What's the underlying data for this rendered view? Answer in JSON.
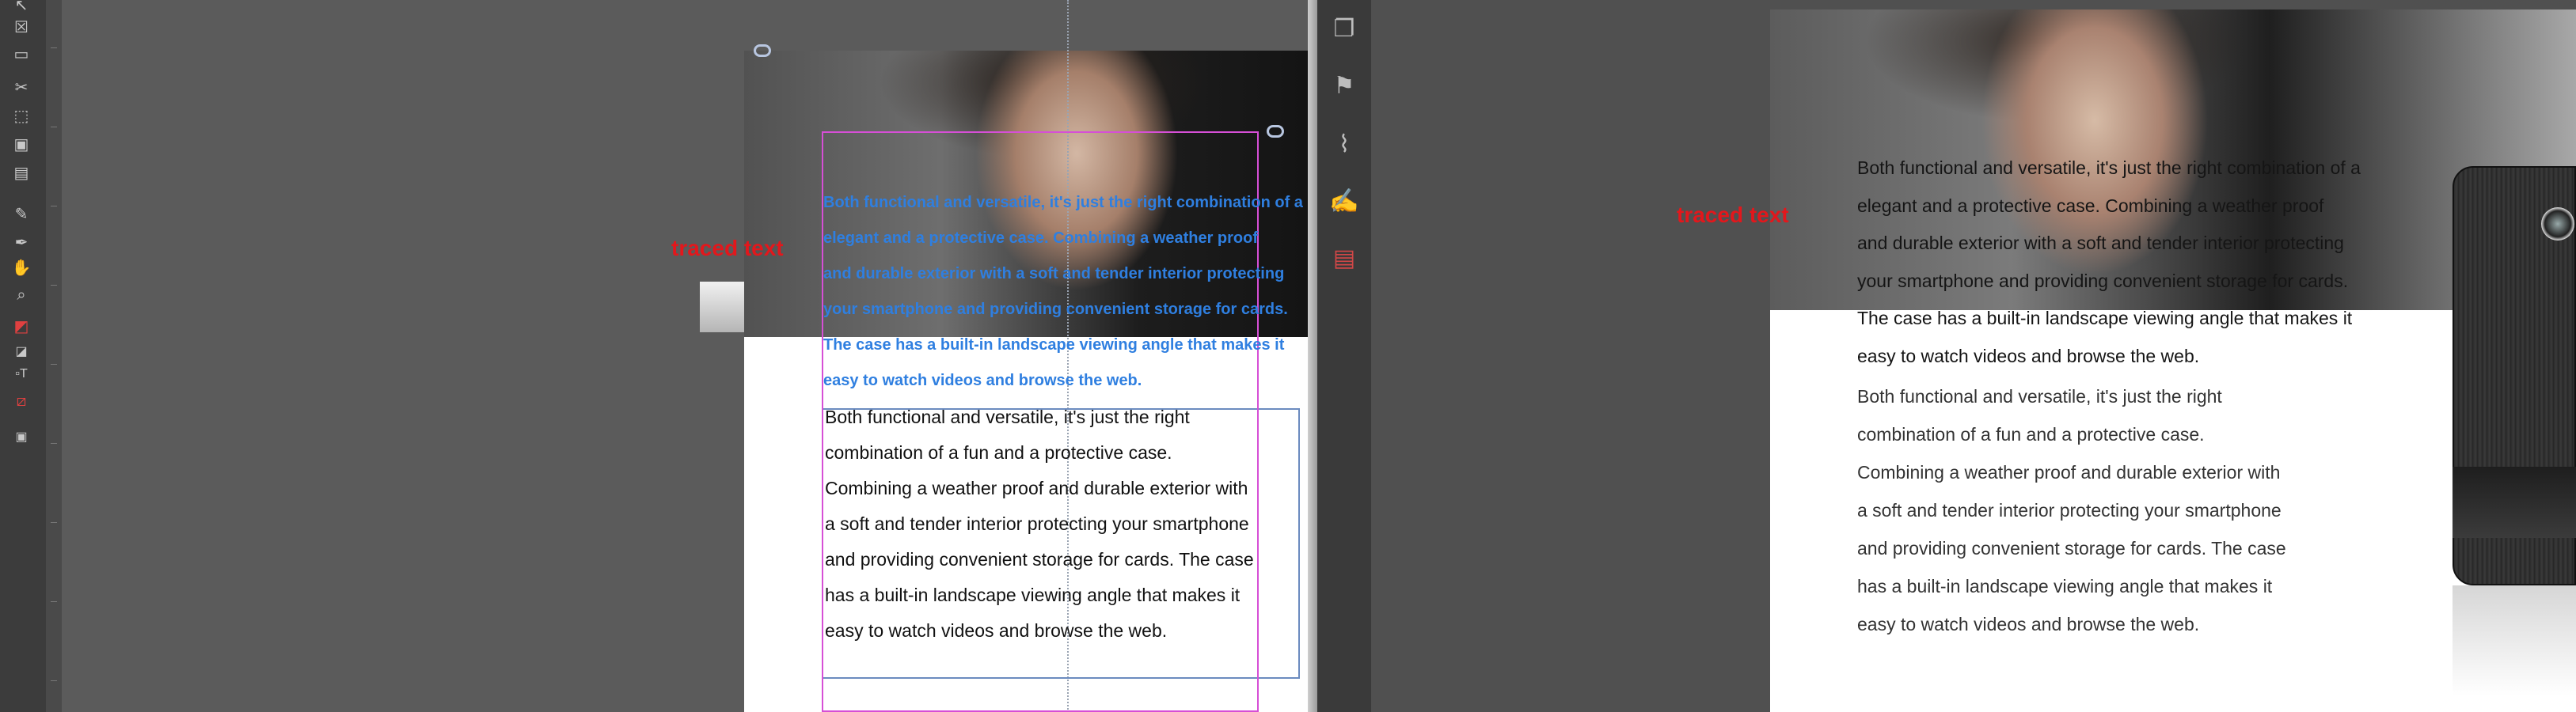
{
  "annotation": {
    "label": "traced text",
    "color": "#e3171c"
  },
  "colors": {
    "selection_frame": "#d64fd6",
    "text_frame": "#6b8bbf",
    "traced_text": "#2f7fe0"
  },
  "toolbar": {
    "tools": [
      "selection-tool",
      "frame-tool",
      "rectangle-tool",
      "scissors-tool",
      "transform-tool",
      "gradient-tool",
      "gradient-feather-tool",
      "note-tool",
      "eyedropper-tool",
      "hand-tool",
      "zoom-tool",
      "fill-stroke-swatch",
      "default-colors",
      "formatting-text",
      "apply-none",
      "screen-mode"
    ]
  },
  "indesign": {
    "traced_lines": [
      "Both functional and versatile, it's just the right combination of a",
      "elegant and a protective case. Combining a weather proof",
      "and durable exterior with a soft and tender interior protecting",
      "your smartphone and providing convenient storage for cards.",
      "The case has a built-in landscape viewing angle that makes it",
      "easy to watch videos and browse the web."
    ],
    "body_lines": [
      "Both functional and versatile, it's just the right",
      "combination of a fun and a protective case.",
      "Combining a weather proof and durable exterior with",
      "a soft and tender interior protecting your smartphone",
      "and providing convenient storage for cards. The case",
      "has a built-in landscape viewing angle that makes it",
      "easy to watch videos and browse the web."
    ]
  },
  "acrobat": {
    "side_icons": [
      "pages-icon",
      "bookmark-icon",
      "attachment-icon",
      "signature-icon",
      "security-icon"
    ],
    "traced_lines": [
      "Both functional and versatile, it's just the right combination of a",
      "elegant and a protective case. Combining a weather proof",
      "and durable exterior with a soft and tender interior protecting",
      "your smartphone and providing convenient storage for cards.",
      "The case has a built-in landscape viewing angle that makes it",
      "easy to watch videos and browse the web."
    ],
    "body_lines": [
      "Both functional and versatile, it's just the right",
      "combination of a fun and a protective case.",
      "Combining a weather proof and durable exterior with",
      "a soft and tender interior protecting your smartphone",
      "and providing convenient storage for cards. The case",
      "has a built-in landscape viewing angle that makes it",
      "easy to watch videos and browse the web."
    ]
  }
}
